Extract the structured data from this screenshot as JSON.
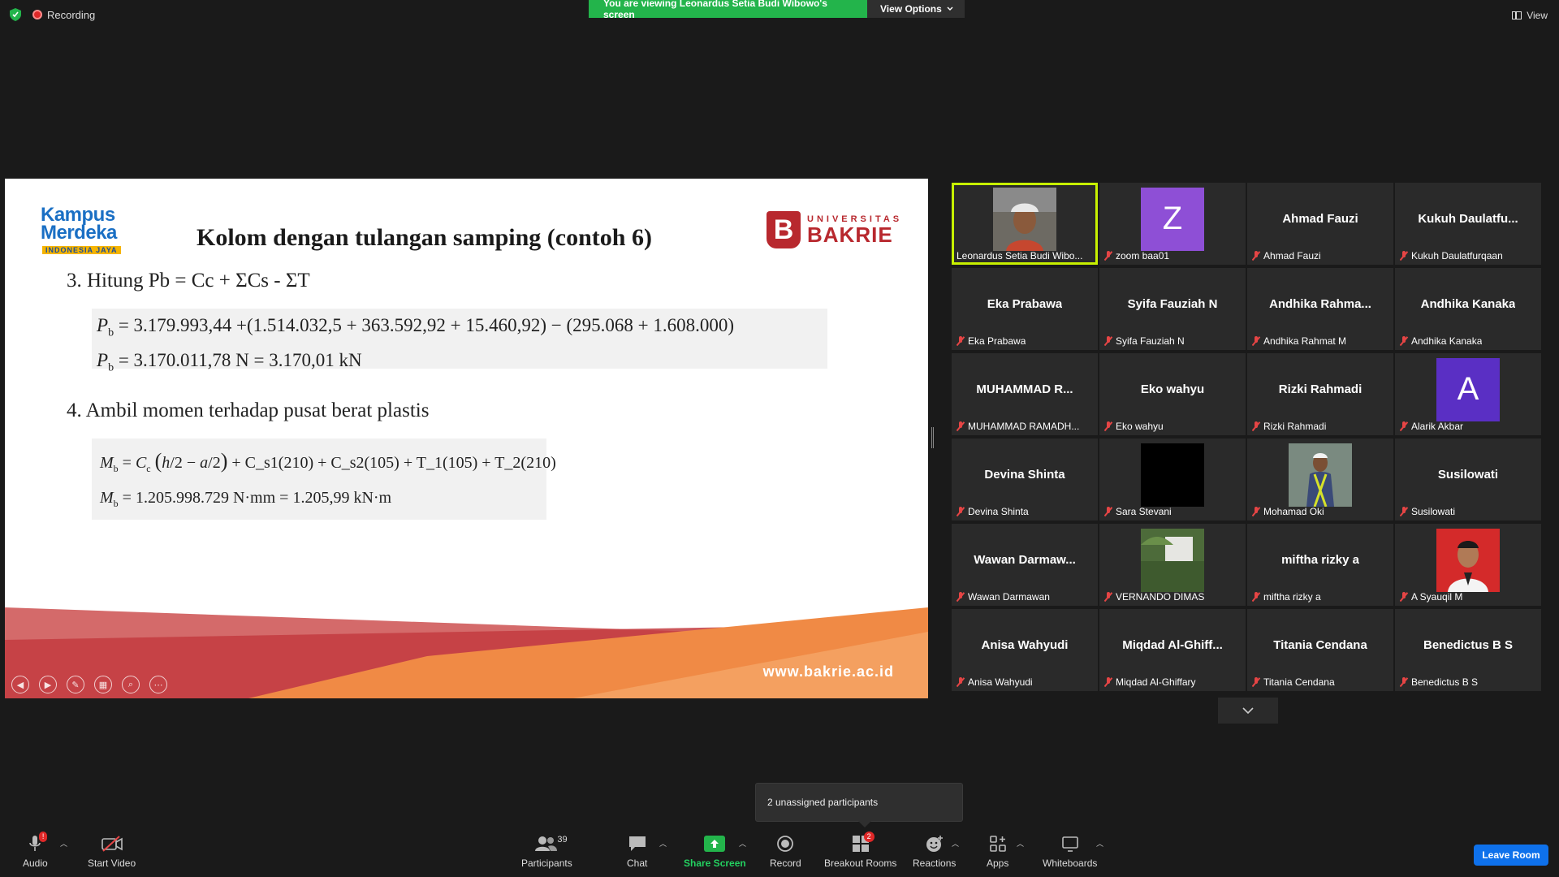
{
  "top": {
    "recording": "Recording",
    "viewing_banner": "You are viewing Leonardus Setia Budi Wibowo's screen",
    "view_options": "View Options",
    "view": "View"
  },
  "slide": {
    "title": "Kolom dengan tulangan samping (contoh 6)",
    "logo_left": {
      "line1": "Kampus",
      "line2": "Merdeka",
      "line3": "INDONESIA JAYA"
    },
    "logo_right": {
      "line1": "UNIVERSITAS",
      "line2": "BAKRIE",
      "mark": "B"
    },
    "step3": "3. Hitung Pb = Cc + ΣCs - ΣT",
    "eq3_line1": "= 3.179.993,44 +(1.514.032,5 + 363.592,92 + 15.460,92) − (295.068 + 1.608.000)",
    "eq3_line2": "= 3.170.011,78 N = 3.170,01 kN",
    "step4": "4. Ambil momen terhadap pusat berat plastis",
    "eq4_line1": "+ C_s1(210) + C_s2(105) + T_1(105) + T_2(210)",
    "eq4_line2": "= 1.205.998.729 N·mm = 1.205,99 kN·m",
    "website": "www.bakrie.ac.id",
    "colors": {
      "footer_red": "#c43c3c",
      "footer_orange": "#f07a3a"
    }
  },
  "gallery": {
    "tiles": [
      {
        "big": "",
        "name": "Leonardus Setia Budi Wibo...",
        "type": "photo",
        "active": true,
        "muted": false
      },
      {
        "big": "Z",
        "name": "zoom baa01",
        "type": "letter",
        "color": "#8e4fd6",
        "muted": true
      },
      {
        "big": "Ahmad Fauzi",
        "name": "Ahmad Fauzi",
        "type": "text",
        "muted": true
      },
      {
        "big": "Kukuh  Daulatfu...",
        "name": "Kukuh Daulatfurqaan",
        "type": "text",
        "muted": true
      },
      {
        "big": "Eka Prabawa",
        "name": "Eka Prabawa",
        "type": "text",
        "muted": true
      },
      {
        "big": "Syifa Fauziah N",
        "name": "Syifa Fauziah N",
        "type": "text",
        "muted": true
      },
      {
        "big": "Andhika  Rahma...",
        "name": "Andhika Rahmat M",
        "type": "text",
        "muted": true
      },
      {
        "big": "Andhika Kanaka",
        "name": "Andhika Kanaka",
        "type": "text",
        "muted": true
      },
      {
        "big": "MUHAMMAD  R...",
        "name": "MUHAMMAD RAMADH...",
        "type": "text",
        "muted": true
      },
      {
        "big": "Eko wahyu",
        "name": "Eko wahyu",
        "type": "text",
        "muted": true
      },
      {
        "big": "Rizki Rahmadi",
        "name": "Rizki Rahmadi",
        "type": "text",
        "muted": true
      },
      {
        "big": "A",
        "name": "Alarik Akbar",
        "type": "letter",
        "color": "#5a2fc4",
        "muted": true
      },
      {
        "big": "Devina Shinta",
        "name": "Devina Shinta",
        "type": "text",
        "muted": true
      },
      {
        "big": "",
        "name": "Sara Stevani",
        "type": "black",
        "muted": true
      },
      {
        "big": "",
        "name": "Mohamad Oki",
        "type": "photo2",
        "muted": true
      },
      {
        "big": "Susilowati",
        "name": "Susilowati",
        "type": "text",
        "muted": true
      },
      {
        "big": "Wawan  Darmaw...",
        "name": "Wawan Darmawan",
        "type": "text",
        "muted": true
      },
      {
        "big": "",
        "name": "VERNANDO DIMAS",
        "type": "photo3",
        "muted": true
      },
      {
        "big": "miftha rizky a",
        "name": "miftha rizky a",
        "type": "text",
        "muted": true
      },
      {
        "big": "",
        "name": "A Syauqil M",
        "type": "photo4",
        "muted": true
      },
      {
        "big": "Anisa Wahyudi",
        "name": "Anisa Wahyudi",
        "type": "text",
        "muted": true
      },
      {
        "big": "Miqdad  Al-Ghiff...",
        "name": "Miqdad Al-Ghiffary",
        "type": "text",
        "muted": true
      },
      {
        "big": "Titania Cendana",
        "name": "Titania Cendana",
        "type": "text",
        "muted": true
      },
      {
        "big": "Benedictus B S",
        "name": "Benedictus B S",
        "type": "text",
        "muted": true
      }
    ]
  },
  "tooltip": "2 unassigned participants",
  "toolbar": {
    "audio": "Audio",
    "audio_badge": "!",
    "start_video": "Start Video",
    "participants": "Participants",
    "participants_count": "39",
    "chat": "Chat",
    "share_screen": "Share Screen",
    "record": "Record",
    "breakout_rooms": "Breakout Rooms",
    "breakout_badge": "2",
    "reactions": "Reactions",
    "apps": "Apps",
    "whiteboards": "Whiteboards",
    "leave_room": "Leave Room"
  },
  "icons": [
    "shield-icon",
    "record-dot-icon",
    "view-grid-icon",
    "chevron-down-icon",
    "mic-icon",
    "video-off-icon",
    "people-icon",
    "chat-icon",
    "share-arrow-icon",
    "record-icon",
    "breakout-grid-icon",
    "smiley-icon",
    "apps-icon",
    "whiteboard-icon",
    "mic-muted-icon"
  ]
}
